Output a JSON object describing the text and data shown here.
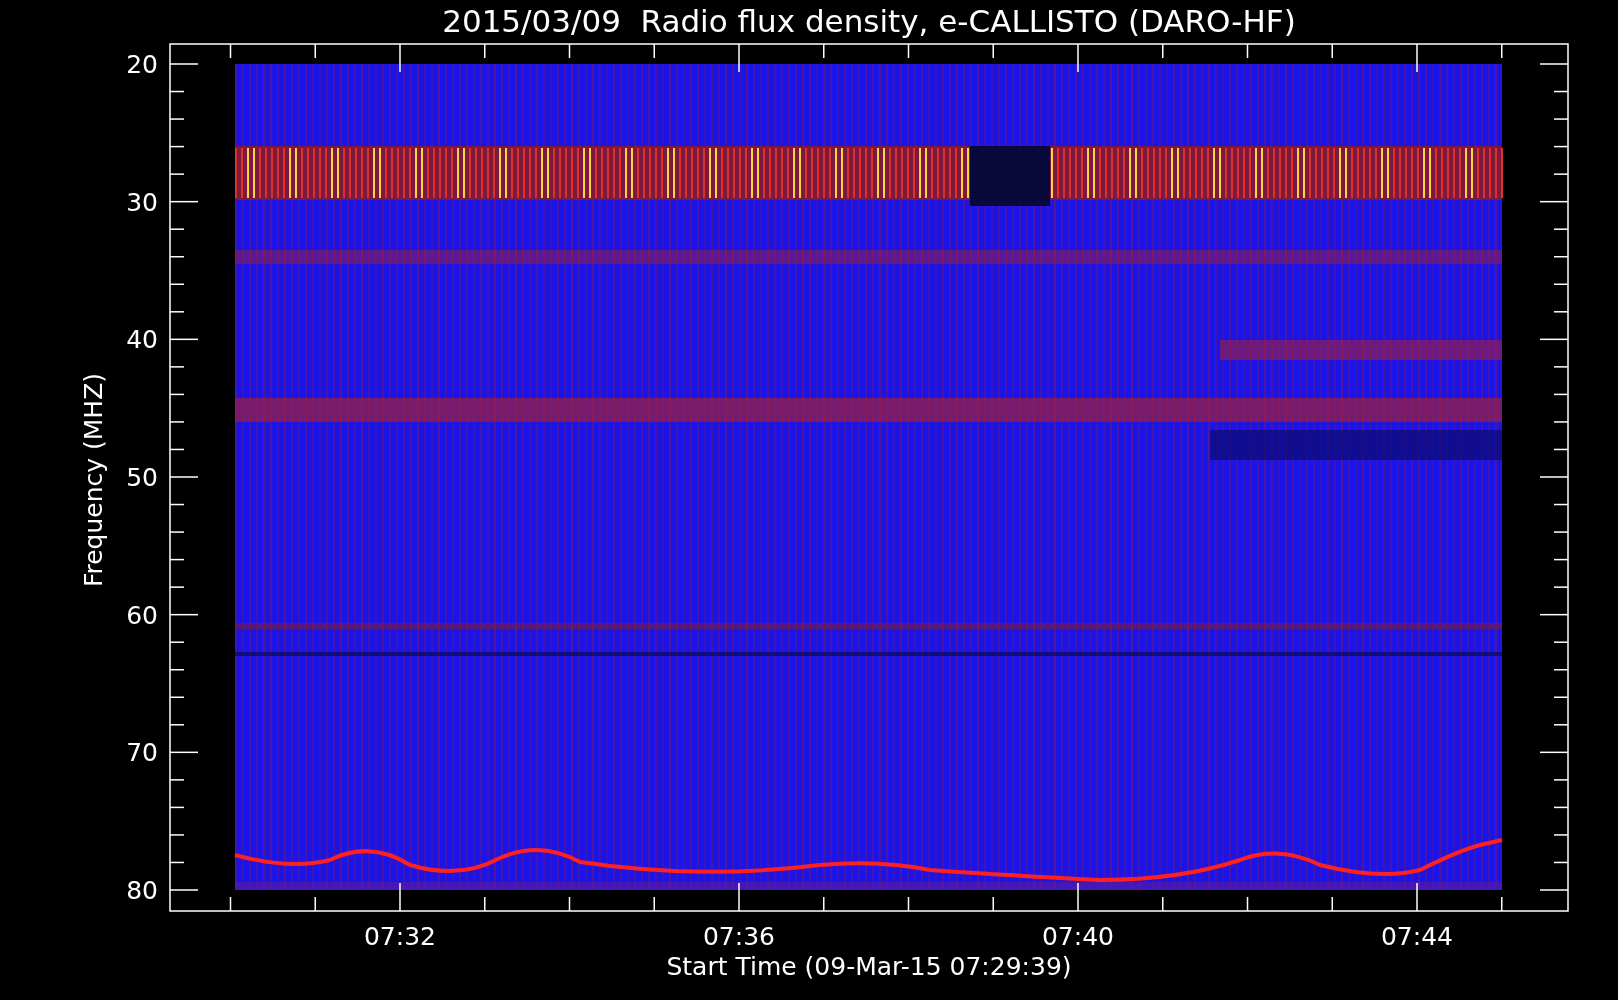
{
  "title": "2015/03/09  Radio flux density, e-CALLISTO (DARO-HF)",
  "y_axis": {
    "label": "Frequency (MHZ)",
    "ticks": [
      "20",
      "30",
      "40",
      "50",
      "60",
      "70",
      "80"
    ]
  },
  "x_axis": {
    "label": "Start Time (09-Mar-15 07:29:39)",
    "ticks": [
      "07:32",
      "07:36",
      "07:40",
      "07:44"
    ]
  }
}
